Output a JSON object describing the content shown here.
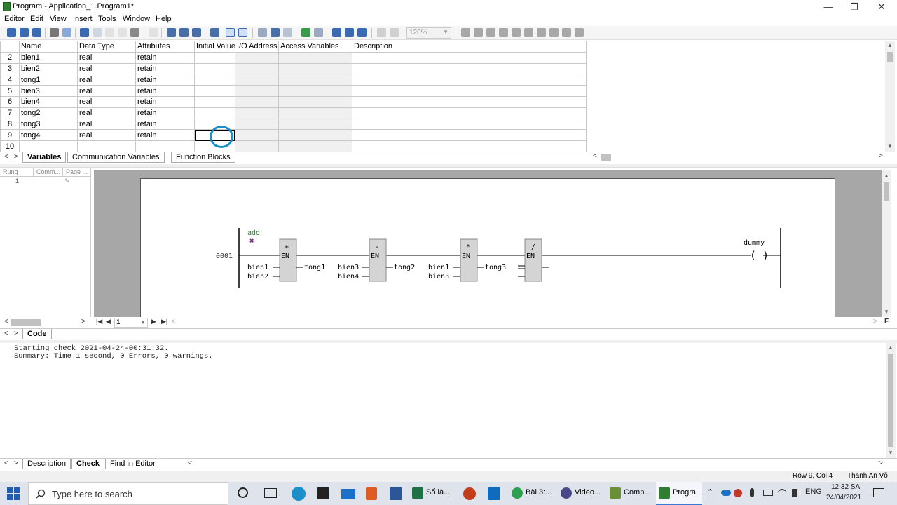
{
  "window": {
    "title": "Program - Application_1.Program1*"
  },
  "menu": [
    "Editor",
    "Edit",
    "View",
    "Insert",
    "Tools",
    "Window",
    "Help"
  ],
  "toolbar": {
    "zoom": "120%"
  },
  "variables_table": {
    "columns": [
      "Name",
      "Data Type",
      "Attributes",
      "Initial Value",
      "I/O Address",
      "Access Variables",
      "Description"
    ],
    "rows": [
      {
        "num": "2",
        "name": "bien1",
        "type": "real",
        "attr": "retain"
      },
      {
        "num": "3",
        "name": "bien2",
        "type": "real",
        "attr": "retain"
      },
      {
        "num": "4",
        "name": "tong1",
        "type": "real",
        "attr": "retain"
      },
      {
        "num": "5",
        "name": "bien3",
        "type": "real",
        "attr": "retain"
      },
      {
        "num": "6",
        "name": "bien4",
        "type": "real",
        "attr": "retain"
      },
      {
        "num": "7",
        "name": "tong2",
        "type": "real",
        "attr": "retain"
      },
      {
        "num": "8",
        "name": "tong3",
        "type": "real",
        "attr": "retain"
      },
      {
        "num": "9",
        "name": "tong4",
        "type": "real",
        "attr": "retain"
      },
      {
        "num": "10",
        "name": "",
        "type": "",
        "attr": ""
      }
    ]
  },
  "var_tabs": [
    "Variables",
    "Communication Variables",
    "Function Blocks"
  ],
  "rung_panel": {
    "headers": [
      "Rung",
      "Comm...",
      "Page ..."
    ],
    "rung_number": "1"
  },
  "ladder": {
    "label": "add",
    "rung_id": "0001",
    "coil_name": "dummy",
    "coil_symbol": "( )",
    "blocks": [
      {
        "op": "+",
        "en": "EN",
        "in1": "bien1",
        "in2": "bien2",
        "out": "tong1"
      },
      {
        "op": "-",
        "en": "EN",
        "in1": "bien3",
        "in2": "bien4",
        "out": "tong2"
      },
      {
        "op": "*",
        "en": "EN",
        "in1": "bien1",
        "in2": "bien3",
        "out": "tong3"
      },
      {
        "op": "/",
        "en": "EN",
        "in1": "",
        "in2": "",
        "out": ""
      }
    ]
  },
  "page_selector": "1",
  "code_tabs": [
    "Code"
  ],
  "output": [
    "Starting check 2021-04-24-00:31:32.",
    "Summary: Time 1 second, 0 Errors, 0 warnings."
  ],
  "output_tabs": [
    "Description",
    "Check",
    "Find in Editor"
  ],
  "status": {
    "position": "Row 9, Col 4",
    "user": "Thanh An Võ"
  },
  "taskbar": {
    "search_placeholder": "Type here to search",
    "apps": [
      {
        "label": "Sổ là...",
        "color": "#1e7145"
      },
      {
        "label": "Bài 3:...",
        "color": "#2e9e4f"
      },
      {
        "label": "Video...",
        "color": "#4a4a8a"
      },
      {
        "label": "Comp...",
        "color": "#6a8f3a"
      },
      {
        "label": "Progra...",
        "color": "#2e7d32"
      }
    ],
    "lang": "ENG",
    "time": "12:32 SA",
    "date": "24/04/2021"
  },
  "colors": {
    "accent": "#1a8fc9",
    "ladder_bg": "#a7a7a7",
    "block_fill": "#d4d4d4"
  }
}
